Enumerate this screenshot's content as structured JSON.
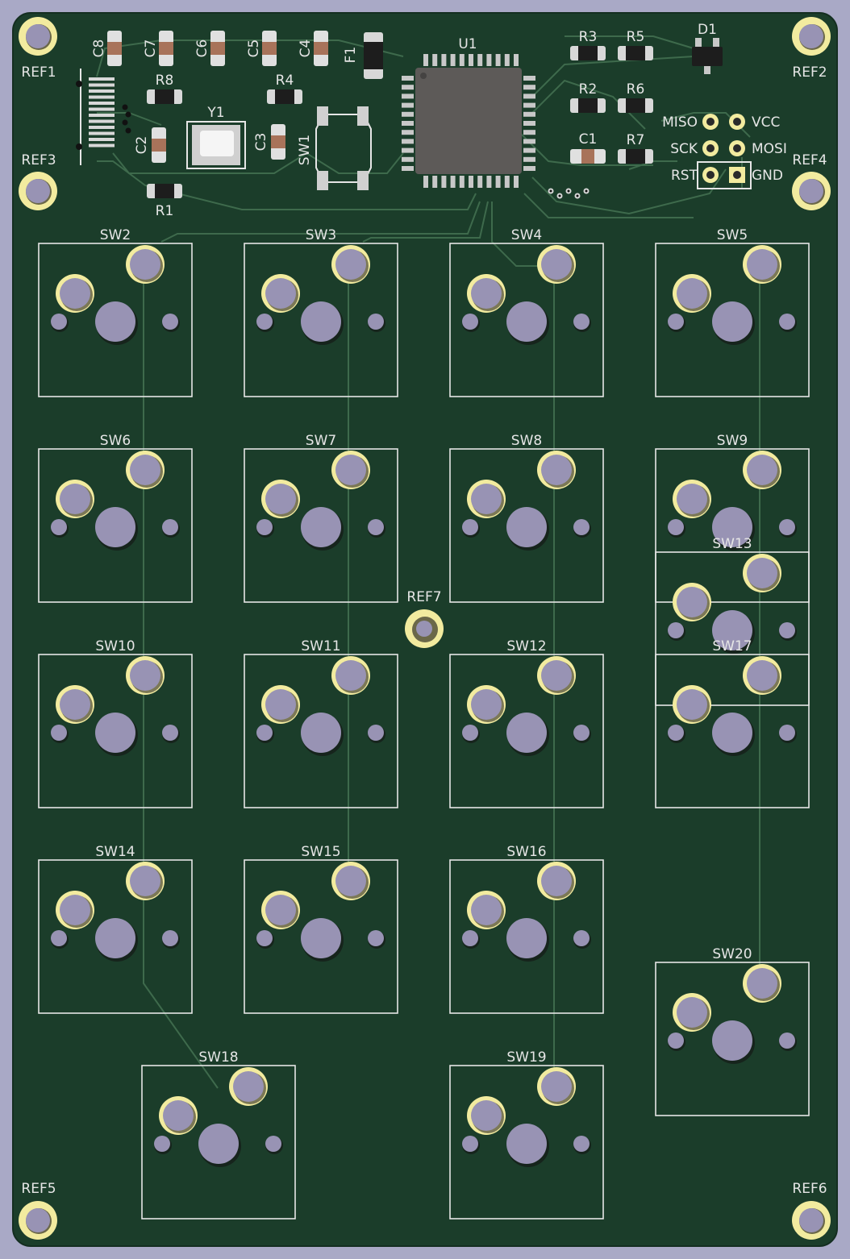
{
  "colors": {
    "background": "#a9a9c6",
    "board": "#1b3d2a",
    "trace": "#3e6a4c",
    "silkscreen": "#e6e6e6",
    "pad_ring": "#f2eb9f",
    "hole": "#9893b4",
    "ic_body": "#5d5a58",
    "pin": "#c8c8c8"
  },
  "mounting_holes": [
    "REF1",
    "REF2",
    "REF3",
    "REF4",
    "REF5",
    "REF6",
    "REF7"
  ],
  "switches": [
    "SW2",
    "SW3",
    "SW4",
    "SW5",
    "SW6",
    "SW7",
    "SW8",
    "SW9",
    "SW10",
    "SW11",
    "SW12",
    "SW13",
    "SW14",
    "SW15",
    "SW16",
    "SW17",
    "SW18",
    "SW19",
    "SW20"
  ],
  "components": {
    "capacitors": [
      "C8",
      "C7",
      "C6",
      "C5",
      "C4",
      "C2",
      "C3",
      "C1"
    ],
    "resistors": [
      "R3",
      "R5",
      "R2",
      "R6",
      "R7",
      "R8",
      "R4",
      "R1"
    ],
    "mcu": "U1",
    "crystal": "Y1",
    "fuse": "F1",
    "diode": "D1",
    "reset_switch": "SW1"
  },
  "isp_header": {
    "pins": [
      "MISO",
      "VCC",
      "SCK",
      "MOSI",
      "RST",
      "GND"
    ]
  }
}
